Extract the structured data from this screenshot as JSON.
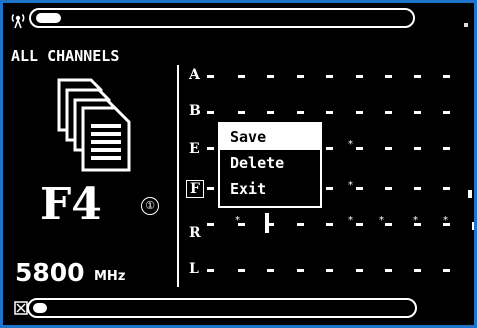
{
  "screen": {
    "title": "ALL CHANNELS",
    "channel": "F4",
    "channel_index": "①",
    "frequency": "5800",
    "frequency_unit": "MHz"
  },
  "top_bar": {
    "icon": "antenna-icon",
    "level": 0.06
  },
  "bottom_bar": {
    "icon": "battery-icon",
    "level": 0.03
  },
  "bands": [
    {
      "label": "A"
    },
    {
      "label": "B"
    },
    {
      "label": "E"
    },
    {
      "label": "F",
      "selected": true
    },
    {
      "label": "R"
    },
    {
      "label": "L"
    }
  ],
  "menu": {
    "items": [
      "Save",
      "Delete",
      "Exit"
    ],
    "selected": "Save"
  },
  "colors": {
    "background": "#000000",
    "foreground": "#ffffff",
    "frame": "#1d74c8"
  }
}
